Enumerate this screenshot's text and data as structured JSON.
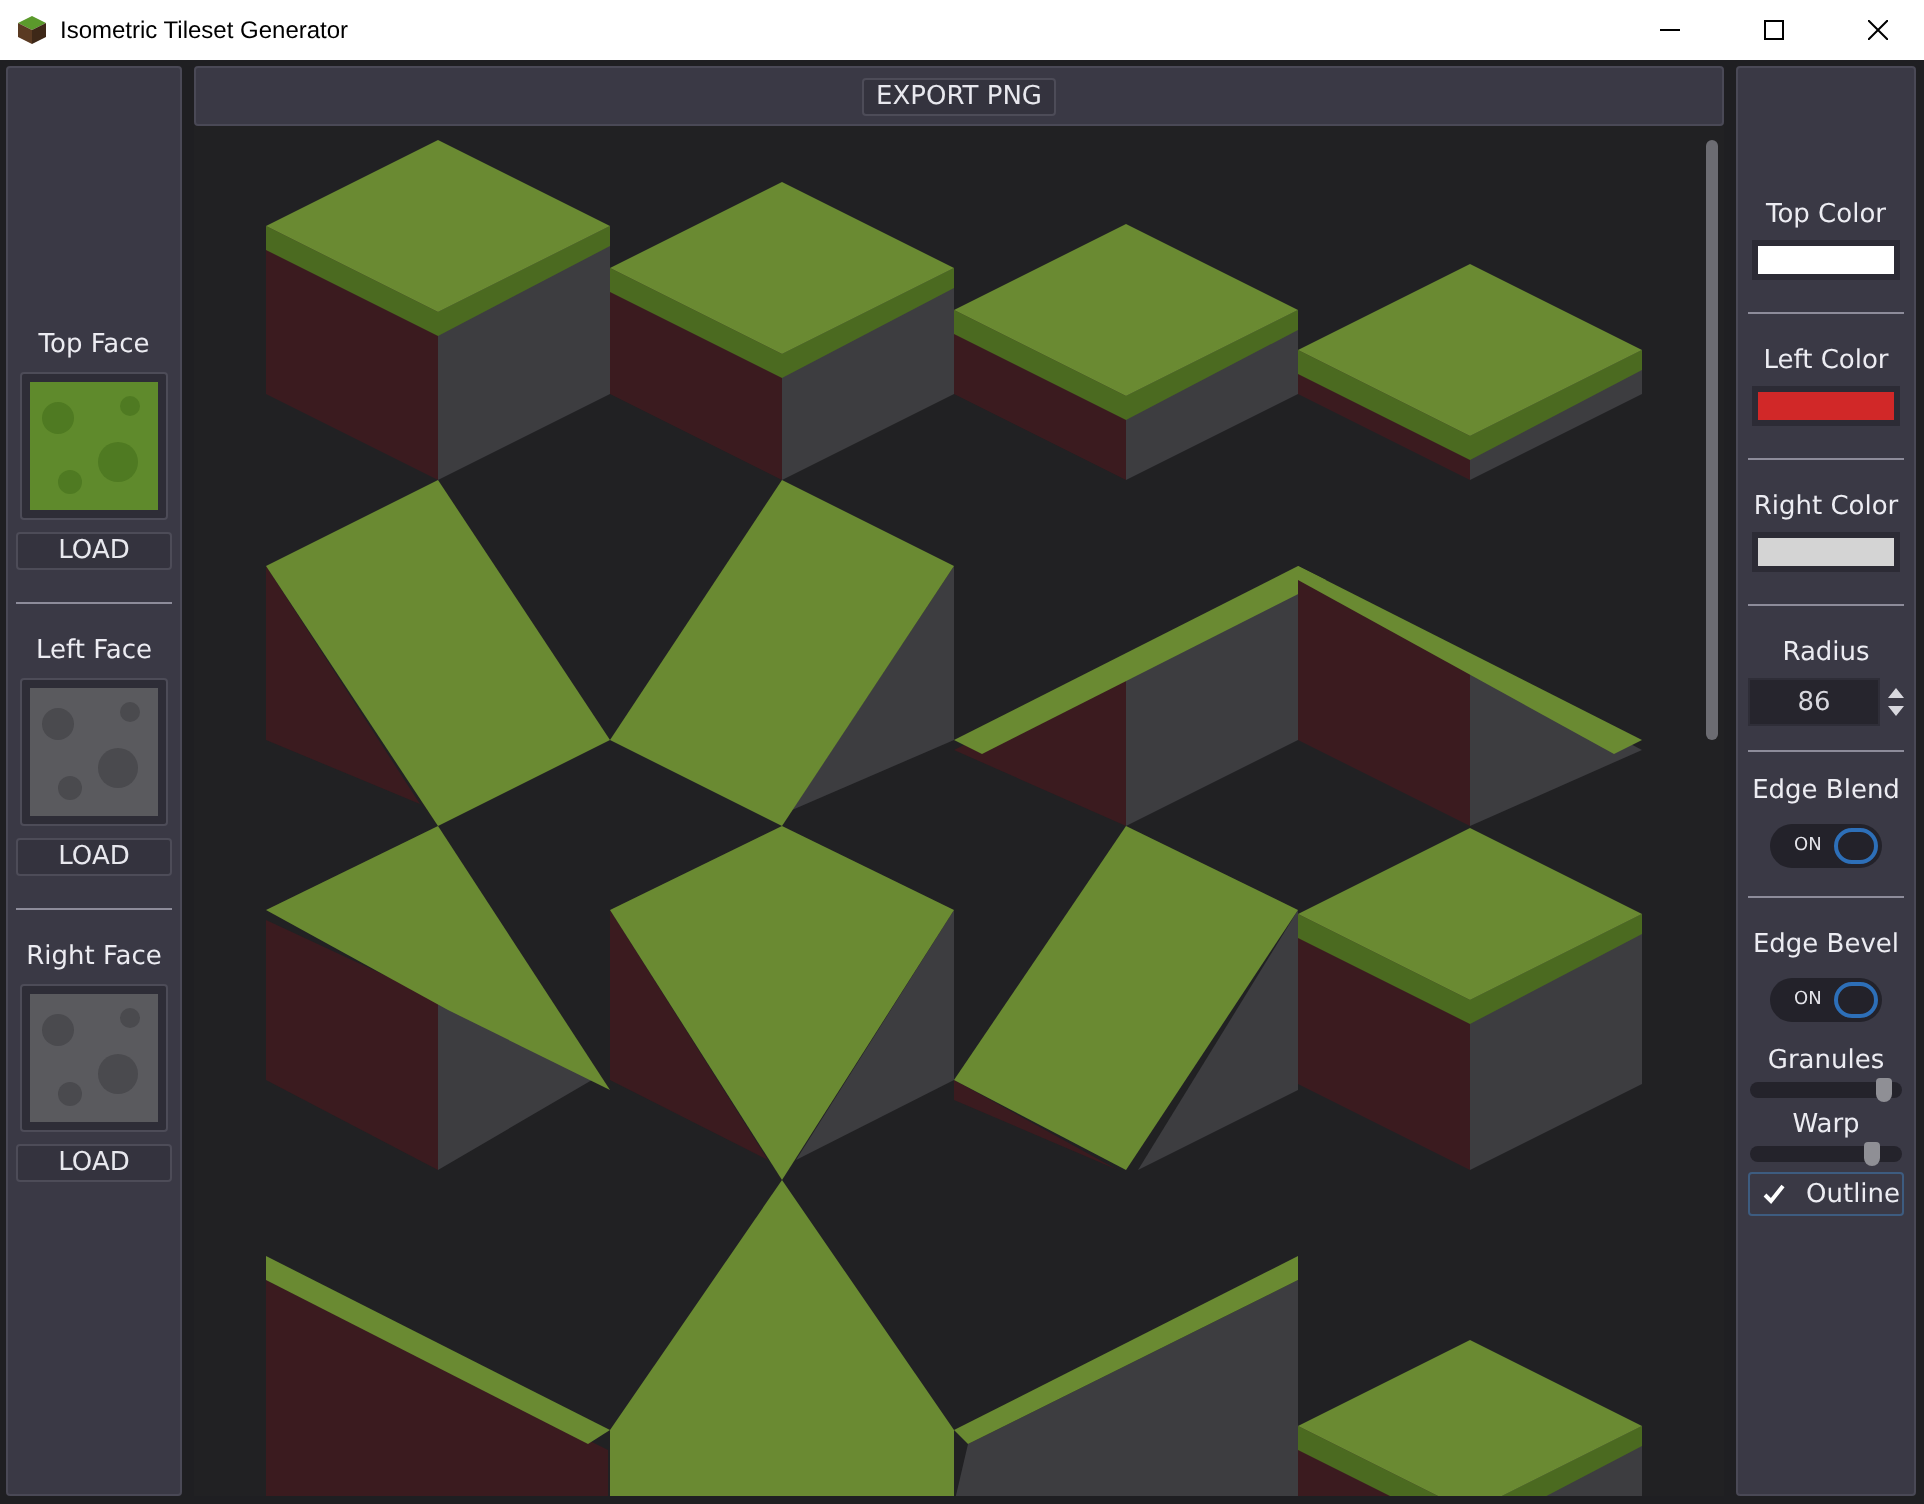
{
  "window": {
    "title": "Isometric Tileset Generator"
  },
  "faces": [
    {
      "label": "Top Face",
      "kind": "grass",
      "button": "LOAD"
    },
    {
      "label": "Left Face",
      "kind": "stone",
      "button": "LOAD"
    },
    {
      "label": "Right Face",
      "kind": "stone",
      "button": "LOAD"
    }
  ],
  "toolbar": {
    "button": "EXPORT PNG"
  },
  "colors": [
    {
      "label": "Top Color",
      "color": "#ffffff"
    },
    {
      "label": "Left Color",
      "color": "#d12828"
    },
    {
      "label": "Right Color",
      "color": "#d4d4d4"
    }
  ],
  "radius": {
    "label": "Radius",
    "value": "86"
  },
  "toggles": [
    {
      "label": "Edge Blend",
      "state": "ON",
      "on": true
    },
    {
      "label": "Edge Bevel",
      "state": "ON",
      "on": true
    }
  ],
  "sliders": [
    {
      "label": "Granules",
      "level": 0.88
    },
    {
      "label": "Warp",
      "level": 0.8
    }
  ],
  "outline": {
    "label": "Outline",
    "checked": true
  }
}
